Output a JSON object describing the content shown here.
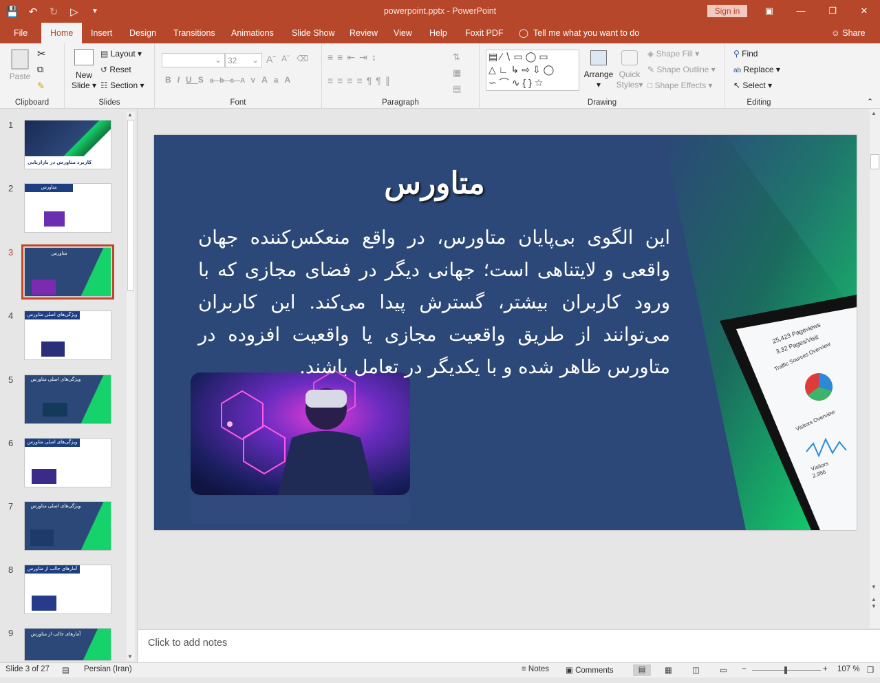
{
  "window": {
    "title": "powerpoint.pptx  -  PowerPoint",
    "sign_in": "Sign in",
    "share": "Share",
    "tell_me": "Tell me what you want to do"
  },
  "tabs": [
    "File",
    "Home",
    "Insert",
    "Design",
    "Transitions",
    "Animations",
    "Slide Show",
    "Review",
    "View",
    "Help",
    "Foxit PDF"
  ],
  "ribbon": {
    "clipboard": {
      "label": "Clipboard",
      "paste": "Paste"
    },
    "slides": {
      "label": "Slides",
      "new_slide_1": "New",
      "new_slide_2": "Slide",
      "layout": "Layout",
      "reset": "Reset",
      "section": "Section"
    },
    "font": {
      "label": "Font",
      "size": "32"
    },
    "paragraph": {
      "label": "Paragraph"
    },
    "drawing": {
      "label": "Drawing",
      "arrange": "Arrange",
      "quick_styles_1": "Quick",
      "quick_styles_2": "Styles",
      "shape_fill": "Shape Fill",
      "shape_outline": "Shape Outline",
      "shape_effects": "Shape Effects"
    },
    "editing": {
      "label": "Editing",
      "find": "Find",
      "replace": "Replace",
      "select": "Select"
    }
  },
  "thumbnails": [
    {
      "num": "1",
      "caption": "کاربرد متاورس در بازاریابی"
    },
    {
      "num": "2",
      "caption": "متاورس"
    },
    {
      "num": "3",
      "caption": "متاورس"
    },
    {
      "num": "4",
      "caption": "ویژگی‌های اصلی متاورس"
    },
    {
      "num": "5",
      "caption": "ویژگی‌های اصلی متاورس"
    },
    {
      "num": "6",
      "caption": "ویژگی‌های اصلی متاورس"
    },
    {
      "num": "7",
      "caption": "ویژگی‌های اصلی متاورس"
    },
    {
      "num": "8",
      "caption": "آمارهای جالب از متاورس"
    },
    {
      "num": "9",
      "caption": "آمارهای جالب از متاورس"
    }
  ],
  "slide": {
    "title": "متاورس",
    "body": "این الگوی بی‌پایان متاورس، در واقع منعکس‌کننده جهان واقعی و لایتناهی است؛ جهانی دیگر در فضای مجازی که با ورود کاربران بیشتر، گسترش پیدا می‌کند. این کاربران می‌توانند از طریق واقعیت مجازی یا واقعیت افزوده در متاورس ظاهر شده و با یکدیگر در تعامل باشند.",
    "tablet": {
      "page_views": "25,423 Pageviews",
      "pages_visit": "3.32 Pages/Visit",
      "traffic": "Traffic Sources Overview",
      "visitors_overview": "Visitors Overview",
      "visitors_label": "Visitors",
      "visitors_value": "2,956"
    }
  },
  "notes_placeholder": "Click to add notes",
  "status": {
    "slide": "Slide 3 of 27",
    "language": "Persian (Iran)",
    "notes": "Notes",
    "comments": "Comments",
    "zoom": "107 %"
  },
  "colors": {
    "accent": "#b7472a",
    "slide_bg": "#2c4878",
    "green": "#15d36a"
  }
}
